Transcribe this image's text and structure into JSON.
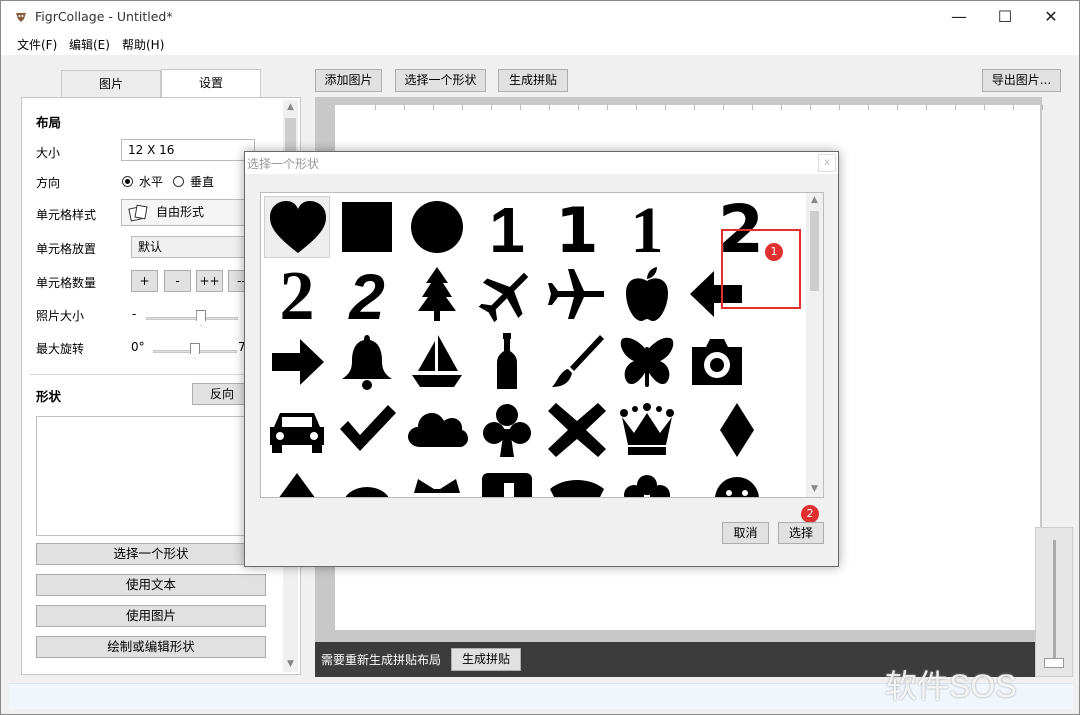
{
  "window": {
    "title": "FigrCollage - Untitled*",
    "minimize": "—",
    "maximize": "☐",
    "close": "✕"
  },
  "menu": [
    "文件(F)",
    "编辑(E)",
    "帮助(H)"
  ],
  "tabs": [
    {
      "label": "图片"
    },
    {
      "label": "设置"
    }
  ],
  "toolbar": {
    "add_images": "添加图片",
    "select_shape": "选择一个形状",
    "generate": "生成拼贴",
    "export": "导出图片..."
  },
  "settings": {
    "layout_title": "布局",
    "size_label": "大小",
    "size_value": "12 X 16",
    "orientation_label": "方向",
    "orientation_h": "水平",
    "orientation_v": "垂直",
    "orientation_selected": "水平",
    "cell_style_label": "单元格样式",
    "cell_style_value": "自由形式",
    "cell_placement_label": "单元格放置",
    "cell_placement_value": "默认",
    "cell_count_label": "单元格数量",
    "cell_count_buttons": [
      "+",
      "-",
      "++",
      "--"
    ],
    "photo_size_label": "照片大小",
    "photo_size_prefix": "-",
    "photo_size_level": 0.6,
    "max_rotation_label": "最大旋转",
    "max_rotation_min": "0°",
    "max_rotation_max": "7",
    "max_rotation_level": 0.5
  },
  "shape_section": {
    "title": "形状",
    "invert_button": "反向",
    "select_shape_button": "选择一个形状",
    "use_text_button": "使用文本",
    "use_image_button": "使用图片",
    "draw_edit_button": "绘制或编辑形状"
  },
  "status": {
    "message": "需要重新生成拼贴布局",
    "button": "生成拼贴"
  },
  "dialog": {
    "title": "选择一个形状",
    "close": "x",
    "cancel": "取消",
    "select": "选择",
    "badge1": "1",
    "badge2": "2",
    "shapes": [
      [
        "heart-icon",
        "square-icon",
        "circle-icon",
        "digit-one-bold-icon",
        "digit-one-sans-icon",
        "digit-one-serif-icon",
        "digit-two-bold-icon"
      ],
      [
        "digit-two-serif-icon",
        "digit-two-italic-icon",
        "pine-tree-icon",
        "airplane-tilted-icon",
        "airplane-icon",
        "apple-icon",
        "arrow-left-icon"
      ],
      [
        "arrow-right-icon",
        "bell-icon",
        "sailboat-icon",
        "bottle-icon",
        "paintbrush-icon",
        "butterfly-icon",
        "camera-icon"
      ],
      [
        "car-icon",
        "checkmark-icon",
        "cloud-icon",
        "club-icon",
        "cross-icon",
        "crown-icon",
        "diamond-icon"
      ]
    ],
    "selected_shape": "heart-icon",
    "highlighted_shape": "digit-two-bold-icon"
  },
  "watermark": "软件SOS"
}
